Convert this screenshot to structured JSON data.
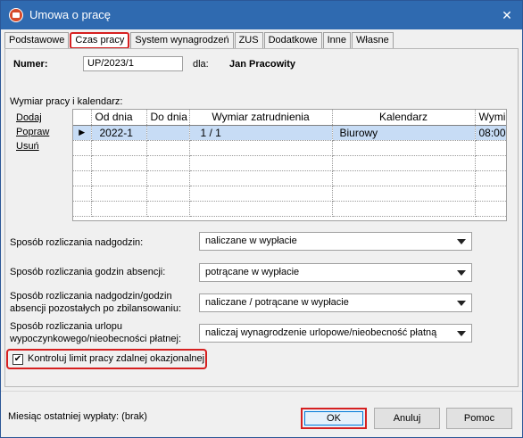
{
  "window": {
    "title": "Umowa o pracę",
    "close_glyph": "✕"
  },
  "tabs": [
    {
      "label": "Podstawowe",
      "active": false
    },
    {
      "label": "Czas pracy",
      "active": true
    },
    {
      "label": "System wynagrodzeń",
      "active": false
    },
    {
      "label": "ZUS",
      "active": false
    },
    {
      "label": "Dodatkowe",
      "active": false
    },
    {
      "label": "Inne",
      "active": false
    },
    {
      "label": "Własne",
      "active": false
    }
  ],
  "header": {
    "numer_label": "Numer:",
    "numer_value": "UP/2023/1",
    "dla_label": "dla:",
    "employee": "Jan Pracowity"
  },
  "section": {
    "title": "Wymiar pracy i kalendarz:"
  },
  "actions": {
    "add": "Dodaj",
    "edit": "Popraw",
    "delete": "Usuń"
  },
  "grid": {
    "columns": [
      "Od dnia",
      "Do dnia",
      "Wymiar zatrudnienia",
      "Kalendarz",
      "Wymi"
    ],
    "rows": [
      {
        "od": "2022-1",
        "do": "",
        "wymiar": "1 / 1",
        "kalendarz": "Biurowy",
        "wymi": "08:00"
      }
    ],
    "row_indicator": "▶"
  },
  "settings": {
    "overtime": {
      "label": "Sposób rozliczania nadgodzin:",
      "value": "naliczane w wypłacie"
    },
    "absence": {
      "label": "Sposób rozliczania godzin absencji:",
      "value": "potrącane w wypłacie"
    },
    "overtime_absence": {
      "label_line1": "Sposób rozliczania nadgodzin/godzin",
      "label_line2": "absencji pozostałych po zbilansowaniu:",
      "value": "naliczane / potrącane w wypłacie"
    },
    "leave": {
      "label_line1": "Sposób rozliczania urlopu",
      "label_line2": "wypoczynkowego/nieobecności płatnej:",
      "value": "naliczaj wynagrodzenie urlopowe/nieobecność płatną"
    }
  },
  "remote_limit": {
    "label": "Kontroluj limit pracy zdalnej okazjonalnej",
    "checked": true,
    "check_glyph": "✔"
  },
  "footer": {
    "last_payment": "Miesiąc ostatniej wypłaty: (brak)",
    "ok": "OK",
    "cancel": "Anuluj",
    "help": "Pomoc"
  }
}
